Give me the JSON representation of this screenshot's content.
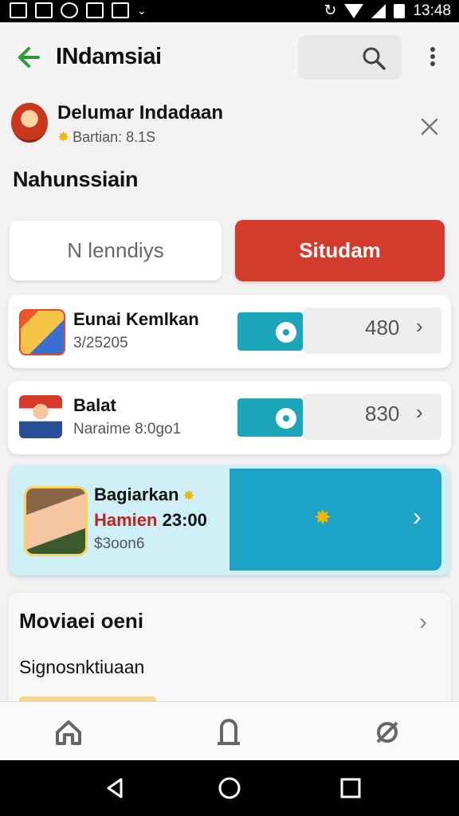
{
  "status_bar": {
    "time": "13:48"
  },
  "app_bar": {
    "title": "INdamsiai",
    "search_icon": "search-icon",
    "more_icon": "more-vert-icon",
    "back_icon": "arrow-left-icon"
  },
  "profile": {
    "name": "Delumar Indadaan",
    "subtitle": "Bartian: 8.1S"
  },
  "section_title": "Nahunssiain",
  "tabs": [
    {
      "label": "N lenndiys"
    },
    {
      "label": "Situdam"
    }
  ],
  "items": [
    {
      "title": "Eunai Kemlkan",
      "subtitle": "3/25205",
      "value": "480"
    },
    {
      "title": "Balat",
      "subtitle": "Naraime 8:0go1",
      "value": "830"
    }
  ],
  "featured": {
    "title": "Bagiarkan",
    "time_label": "Hamien",
    "time_value": "23:00",
    "subtitle": "$3oon6"
  },
  "more": {
    "title": "Moviaei oeni",
    "subtitle": "Signosnktiuaan"
  },
  "colors": {
    "accent_red": "#d33b2c",
    "teal": "#1aa6b8",
    "featured_blue": "#1ea3c8",
    "back_green": "#2a9c3a"
  }
}
